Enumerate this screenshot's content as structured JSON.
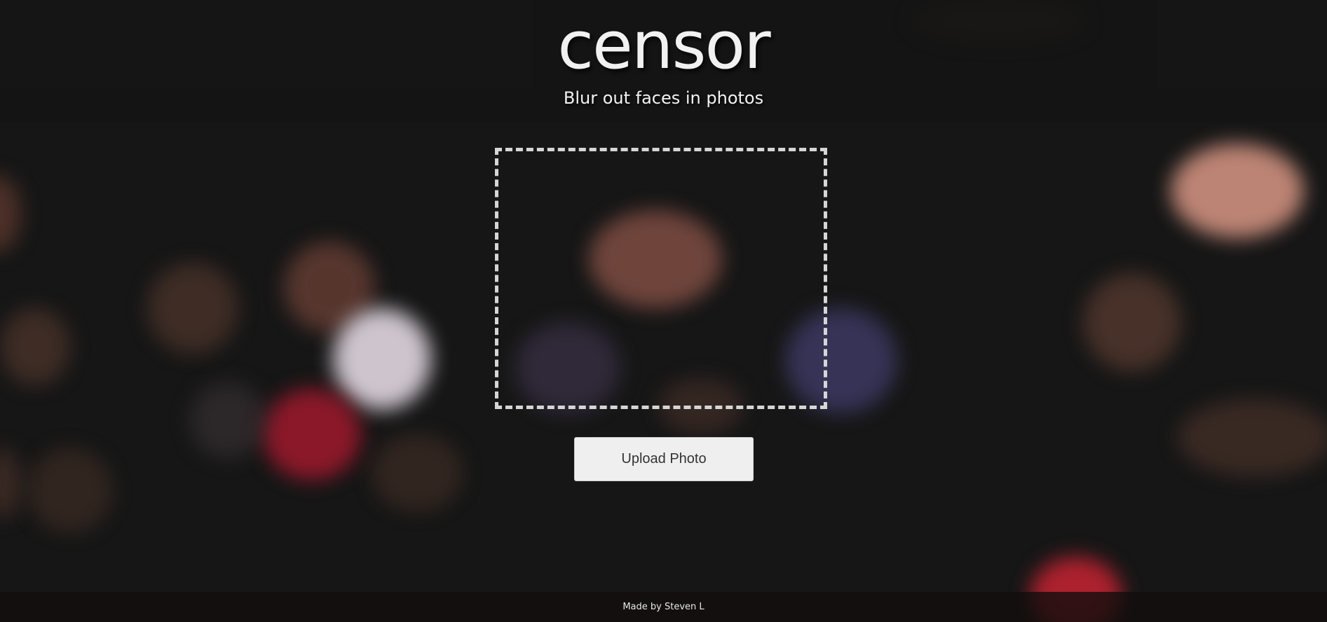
{
  "header": {
    "title": "censor",
    "subtitle": "Blur out faces in photos"
  },
  "main": {
    "dropzone_icon": "photo-dropzone",
    "upload_button_label": "Upload Photo"
  },
  "footer": {
    "credit": "Made by Steven L"
  },
  "colors": {
    "background": "#161616",
    "text": "#f1f1f1",
    "button_bg": "#efefef",
    "dropzone_border": "#d6d6d6"
  }
}
